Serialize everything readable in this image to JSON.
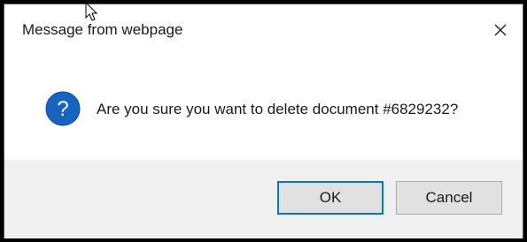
{
  "dialog": {
    "title": "Message from webpage",
    "message": "Are you sure you want to delete document #6829232?",
    "icon": "question-icon",
    "close_icon": "close-icon",
    "accent_color": "#0078d7",
    "icon_color": "#1565c0"
  },
  "buttons": {
    "ok_label": "OK",
    "cancel_label": "Cancel"
  }
}
